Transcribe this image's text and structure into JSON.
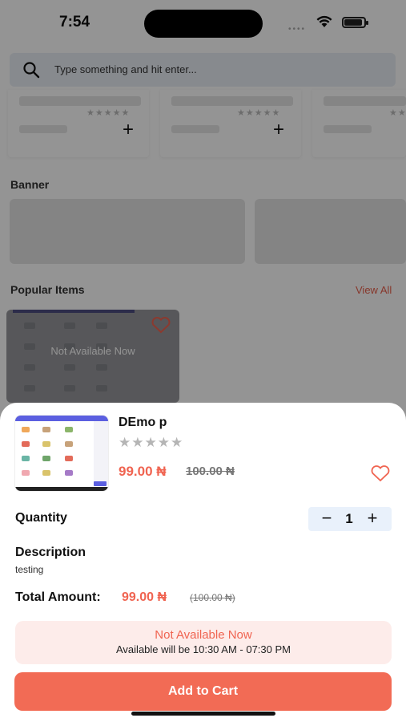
{
  "status": {
    "time": "7:54"
  },
  "search": {
    "placeholder": "Type something and hit enter..."
  },
  "sections": {
    "banner_title": "Banner",
    "popular_title": "Popular Items",
    "view_all": "View All",
    "popular_overlay": "Not Available Now"
  },
  "product": {
    "name": "DEmo p",
    "stars": "★★★★★",
    "rating": 0,
    "price": "99.00 ₦",
    "old_price": "100.00 ₦"
  },
  "quantity": {
    "label": "Quantity",
    "value": "1",
    "minus": "−",
    "plus": "+"
  },
  "description": {
    "label": "Description",
    "text": "testing"
  },
  "total": {
    "label": "Total Amount:",
    "price": "99.00 ₦",
    "old_price": "(100.00 ₦)"
  },
  "availability": {
    "title": "Not Available Now",
    "subtitle": "Available will be 10:30 AM - 07:30 PM"
  },
  "actions": {
    "add_to_cart": "Add to Cart"
  },
  "colors": {
    "accent": "#f26b55",
    "price": "#f06451",
    "stepper_bg": "#e9f1fb",
    "notice_bg": "#fdecea"
  }
}
